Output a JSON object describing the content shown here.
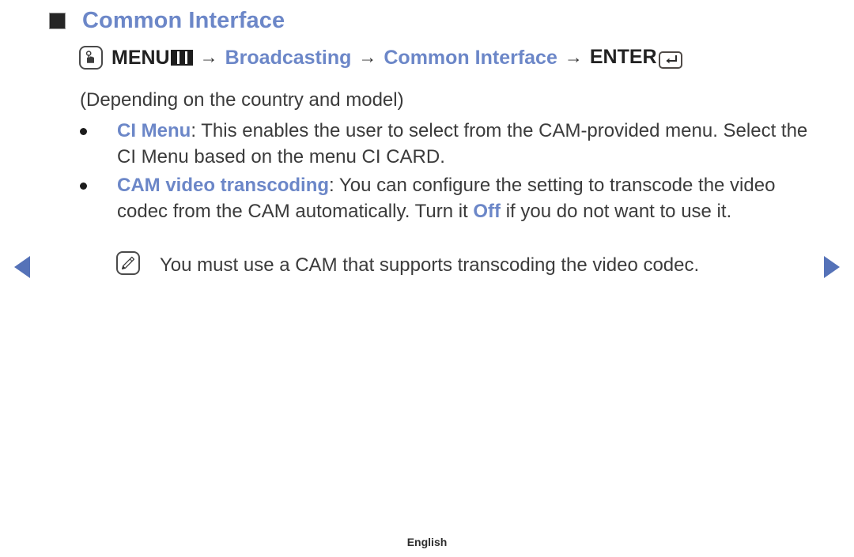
{
  "page": {
    "title": "Common Interface",
    "accent_color": "#6c87c8",
    "arrow_color": "#5572b8",
    "text_color": "#3b3b3b",
    "background_color": "#ffffff"
  },
  "menu_path": {
    "press_icon": "hand-press-icon",
    "menu_label": "MENU",
    "menu_icon": "menu-grid-icon",
    "arrow1": "→",
    "broadcasting_label": "Broadcasting",
    "arrow2": "→",
    "common_interface_label": "Common Interface",
    "arrow3": "→",
    "enter_label": "ENTER",
    "enter_icon": "enter-key-icon"
  },
  "body": {
    "availability_note": "(Depending on the country and model)",
    "bullets": [
      {
        "highlight": "CI Menu",
        "text_after_highlight": ": This enables the user to select from the CAM-provided menu. Select the CI Menu based on the menu CI CARD."
      },
      {
        "highlight": "CAM video transcoding",
        "text_after_highlight": ": You can configure the setting to transcode the video codec from the CAM automatically. Turn it ",
        "inline_highlight": "Off",
        "text_tail": " if you do not want to use it."
      }
    ],
    "note": {
      "icon": "note-pencil-icon",
      "text": "You must use a CAM that supports transcoding the video codec."
    }
  },
  "navigation": {
    "prev_label": "◀",
    "next_label": "▶"
  },
  "footer": {
    "language": "English"
  }
}
